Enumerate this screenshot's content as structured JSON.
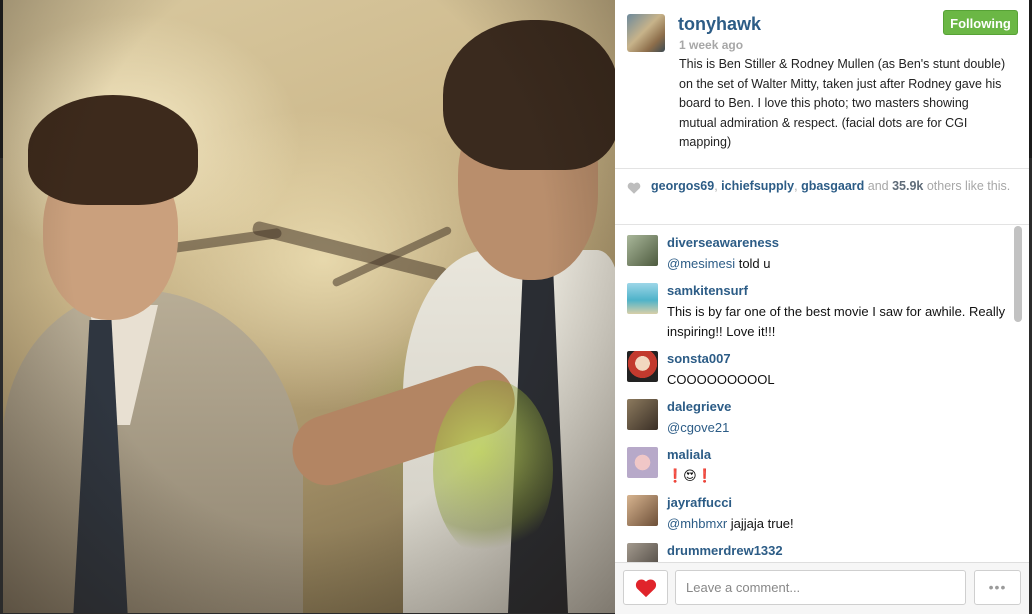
{
  "post": {
    "username": "tonyhawk",
    "time_ago": "1 week ago",
    "follow_label": "Following",
    "caption": "This is Ben Stiller & Rodney Mullen (as Ben's stunt double) on the set of Walter Mitty, taken just after Rodney gave his board to Ben. I love this photo; two masters showing mutual admiration & respect. (facial dots are for CGI mapping)"
  },
  "likes": {
    "users": [
      "georgos69",
      "ichiefsupply",
      "gbasgaard"
    ],
    "sep": ", ",
    "and": " and ",
    "count": "35.9k",
    "suffix": " others like this."
  },
  "comments": [
    {
      "user": "diverseawareness",
      "mention": "@mesimesi",
      "text": " told u",
      "avatar_color": "#6d7d5a"
    },
    {
      "user": "samkitensurf",
      "mention": "",
      "text": "This is by far one of the best movie I saw for awhile. Really inspiring!! Love it!!!",
      "avatar_color": "#4fb3c9"
    },
    {
      "user": "sonsta007",
      "mention": "",
      "text": "COOOOOOOOOL",
      "avatar_color": "#c23a2e"
    },
    {
      "user": "dalegrieve",
      "mention": "@cgove21",
      "text": "",
      "avatar_color": "#5a4a3a"
    },
    {
      "user": "maliala",
      "mention": "",
      "text": "❗😍❗",
      "avatar_color": "#b7a9c9"
    },
    {
      "user": "jayraffucci",
      "mention": "@mhbmxr",
      "text": " jajjaja true!",
      "avatar_color": "#8a6a50"
    },
    {
      "user": "drummerdrew1332",
      "mention": "",
      "text": "",
      "avatar_color": "#6f6a64"
    }
  ],
  "footer": {
    "comment_placeholder": "Leave a comment...",
    "more_label": "•••"
  },
  "colors": {
    "link_blue": "#2c5c86",
    "following_green": "#6bb745",
    "heart_red": "#e0242b"
  },
  "icons": {
    "like": "heart-icon",
    "small_like": "heart-outline-icon",
    "more": "ellipsis-icon"
  }
}
